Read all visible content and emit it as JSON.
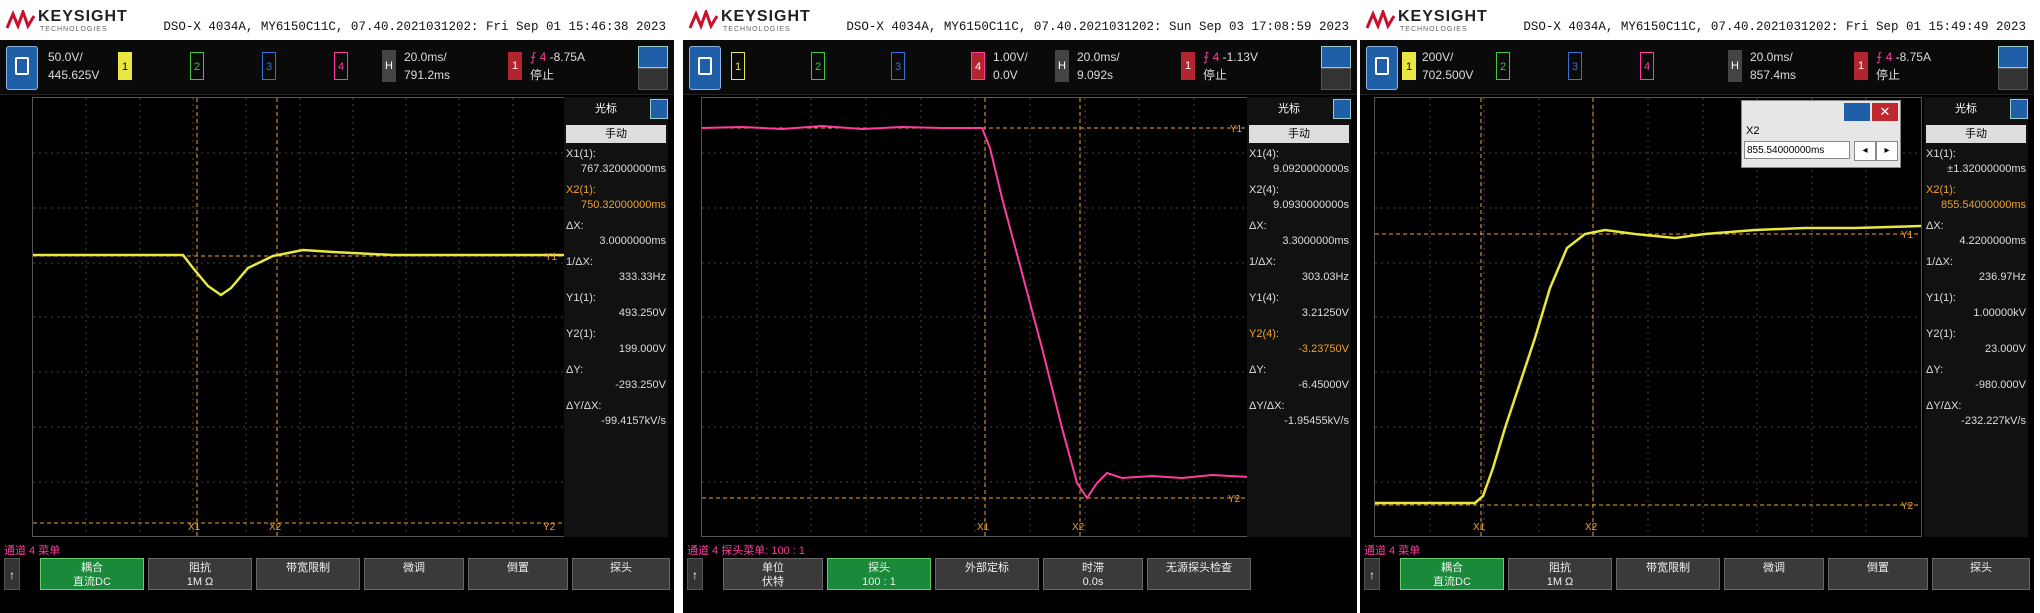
{
  "colors": {
    "ch1": "#e8e840",
    "ch2": "#3fc83f",
    "ch3": "#3b6fd8",
    "ch4": "#ff3da0",
    "cursor": "#f0a030"
  },
  "scopes": [
    {
      "brand": "KEYSIGHT",
      "brand_sub": "TECHNOLOGIES",
      "header": "DSO-X 4034A, MY6150C11C, 07.40.2021031202: Fri Sep 01 15:46:38 2023",
      "ch1_scale": "50.0V/",
      "ch1_offset": "445.625V",
      "h_label": "H",
      "h_scale": "20.0ms/",
      "h_delay": "791.2ms",
      "trig_level": "-8.75A",
      "trig_mode": "停止",
      "side": {
        "title": "光标",
        "mode": "手动",
        "rows": [
          {
            "label": "X1(1):",
            "value": "767.32000000ms"
          },
          {
            "label": "X2(1):",
            "value": "750.32000000ms",
            "orange": true
          },
          {
            "label": "ΔX:",
            "value": "3.0000000ms"
          },
          {
            "label": "1/ΔX:",
            "value": "333.33Hz"
          },
          {
            "label": "Y1(1):",
            "value": "493.250V"
          },
          {
            "label": "Y2(1):",
            "value": "199.000V"
          },
          {
            "label": "ΔY:",
            "value": "-293.250V"
          },
          {
            "label": "ΔY/ΔX:",
            "value": "-99.4157kV/s"
          }
        ]
      },
      "channel_label": "通道 4 菜单",
      "softkeys": [
        {
          "top": "耦合",
          "bottom": "直流DC",
          "green": true
        },
        {
          "top": "阻抗",
          "bottom": "1M Ω"
        },
        {
          "top": "带宽限制",
          "bottom": ""
        },
        {
          "top": "微调",
          "bottom": ""
        },
        {
          "top": "倒置",
          "bottom": ""
        },
        {
          "top": "探头",
          "bottom": ""
        }
      ]
    },
    {
      "brand": "KEYSIGHT",
      "brand_sub": "TECHNOLOGIES",
      "header": "DSO-X 4034A, MY6150C11C, 07.40.2021031202: Sun Sep 03 17:08:59 2023",
      "ch4_scale": "1.00V/",
      "ch4_offset": "0.0V",
      "h_label": "H",
      "h_scale": "20.0ms/",
      "h_delay": "9.092s",
      "trig_level": "-1.13V",
      "trig_mode": "停止",
      "side": {
        "title": "光标",
        "mode": "手动",
        "rows": [
          {
            "label": "X1(4):",
            "value": "9.0920000000s"
          },
          {
            "label": "X2(4):",
            "value": "9.0930000000s"
          },
          {
            "label": "ΔX:",
            "value": "3.3000000ms"
          },
          {
            "label": "1/ΔX:",
            "value": "303.03Hz"
          },
          {
            "label": "Y1(4):",
            "value": "3.21250V"
          },
          {
            "label": "Y2(4):",
            "value": "-3.23750V",
            "orange": true
          },
          {
            "label": "ΔY:",
            "value": "-6.45000V"
          },
          {
            "label": "ΔY/ΔX:",
            "value": "-1.95455kV/s"
          }
        ]
      },
      "channel_label": "通道 4 探头菜单: 100 : 1",
      "softkeys": [
        {
          "top": "单位",
          "bottom": "伏特"
        },
        {
          "top": "探头",
          "bottom": "100 : 1",
          "green": true
        },
        {
          "top": "外部定标",
          "bottom": ""
        },
        {
          "top": "时滞",
          "bottom": "0.0s"
        },
        {
          "top": "无源探头检查",
          "bottom": ""
        }
      ]
    },
    {
      "brand": "KEYSIGHT",
      "brand_sub": "TECHNOLOGIES",
      "header": "DSO-X 4034A, MY6150C11C, 07.40.2021031202: Fri Sep 01 15:49:49 2023",
      "ch1_scale": "200V/",
      "ch1_offset": "702.500V",
      "h_label": "H",
      "h_scale": "20.0ms/",
      "h_delay": "857.4ms",
      "trig_level": "-8.75A",
      "trig_mode": "停止",
      "popup": {
        "title": "X2",
        "value": "855.54000000ms"
      },
      "side": {
        "title": "光标",
        "mode": "手动",
        "rows": [
          {
            "label": "X1(1):",
            "value": "±1.32000000ms"
          },
          {
            "label": "X2(1):",
            "value": "855.54000000ms",
            "orange": true
          },
          {
            "label": "ΔX:",
            "value": "4.2200000ms"
          },
          {
            "label": "1/ΔX:",
            "value": "236.97Hz"
          },
          {
            "label": "Y1(1):",
            "value": "1.00000kV"
          },
          {
            "label": "Y2(1):",
            "value": "23.000V"
          },
          {
            "label": "ΔY:",
            "value": "-980.000V"
          },
          {
            "label": "ΔY/ΔX:",
            "value": "-232.227kV/s"
          }
        ]
      },
      "channel_label": "通道 4 菜单",
      "softkeys": [
        {
          "top": "耦合",
          "bottom": "直流DC",
          "green": true
        },
        {
          "top": "阻抗",
          "bottom": "1M Ω"
        },
        {
          "top": "带宽限制",
          "bottom": ""
        },
        {
          "top": "微调",
          "bottom": ""
        },
        {
          "top": "倒置",
          "bottom": ""
        },
        {
          "top": "探头",
          "bottom": ""
        }
      ]
    }
  ]
}
